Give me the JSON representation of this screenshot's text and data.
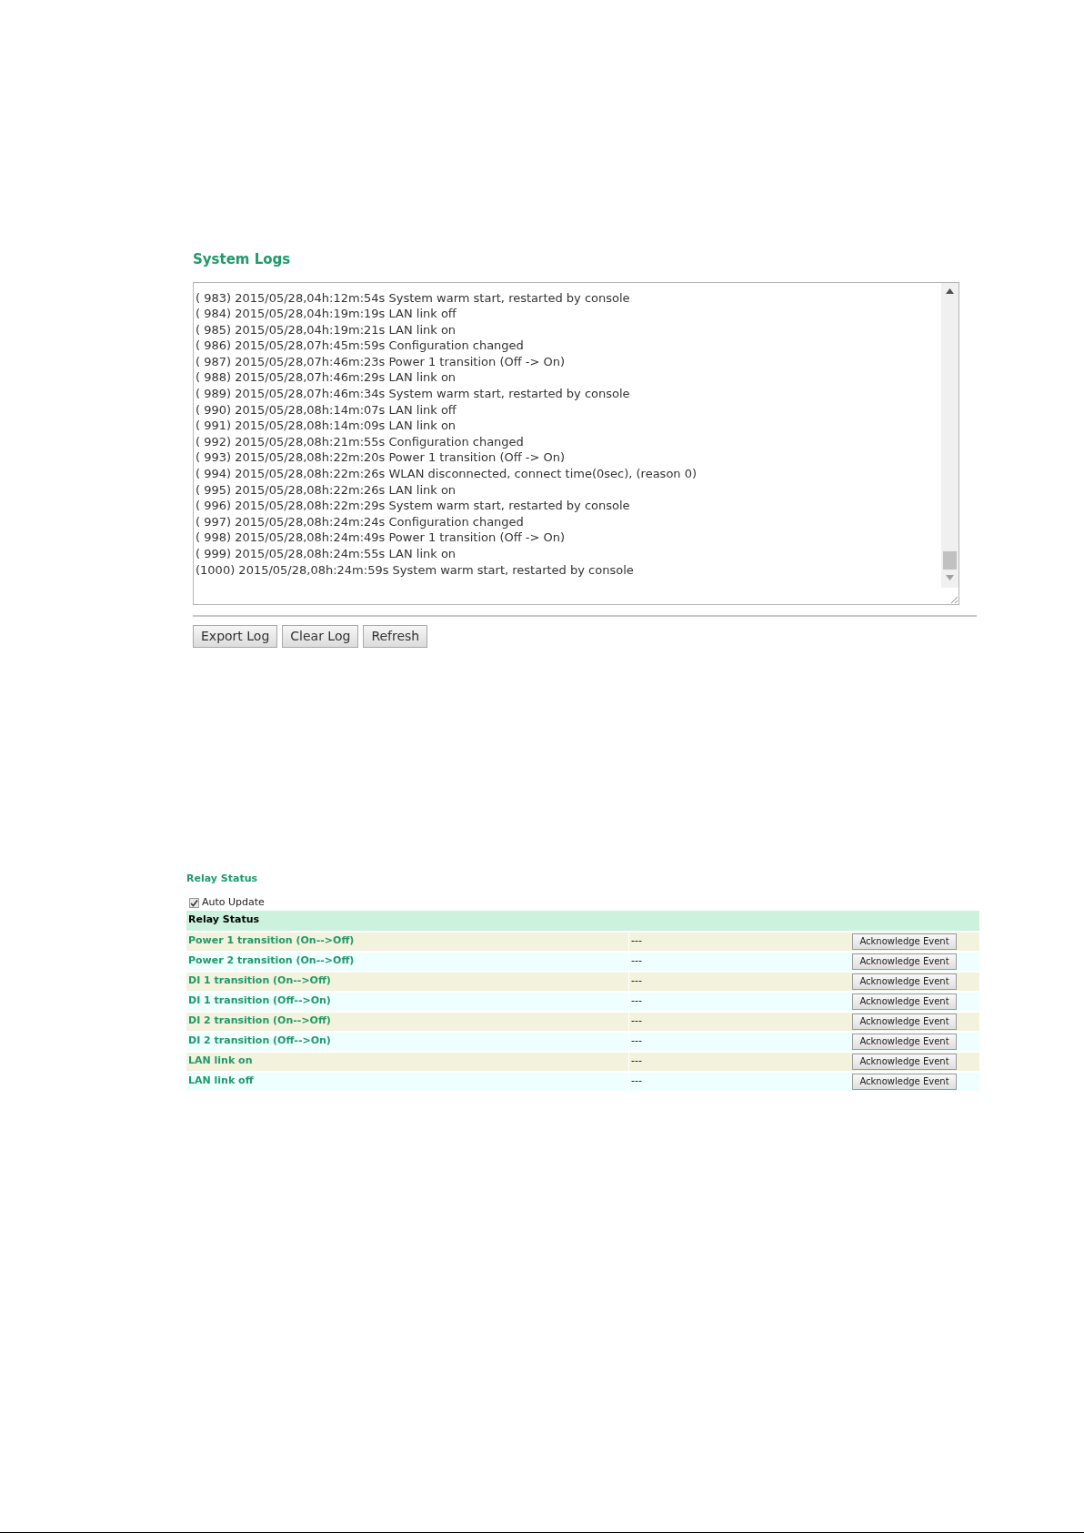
{
  "system_logs": {
    "title": "System Logs",
    "lines": [
      "( 983) 2015/05/28,04h:12m:54s System warm start, restarted by console",
      "( 984) 2015/05/28,04h:19m:19s LAN link off",
      "( 985) 2015/05/28,04h:19m:21s LAN link on",
      "( 986) 2015/05/28,07h:45m:59s Configuration changed",
      "( 987) 2015/05/28,07h:46m:23s Power 1 transition (Off -> On)",
      "( 988) 2015/05/28,07h:46m:29s LAN link on",
      "( 989) 2015/05/28,07h:46m:34s System warm start, restarted by console",
      "( 990) 2015/05/28,08h:14m:07s LAN link off",
      "( 991) 2015/05/28,08h:14m:09s LAN link on",
      "( 992) 2015/05/28,08h:21m:55s Configuration changed",
      "( 993) 2015/05/28,08h:22m:20s Power 1 transition (Off -> On)",
      "( 994) 2015/05/28,08h:22m:26s WLAN disconnected, connect time(0sec), (reason 0)",
      "( 995) 2015/05/28,08h:22m:26s LAN link on",
      "( 996) 2015/05/28,08h:22m:29s System warm start, restarted by console",
      "( 997) 2015/05/28,08h:24m:24s Configuration changed",
      "( 998) 2015/05/28,08h:24m:49s Power 1 transition (Off -> On)",
      "( 999) 2015/05/28,08h:24m:55s LAN link on",
      "(1000) 2015/05/28,08h:24m:59s System warm start, restarted by console"
    ],
    "buttons": [
      "Export Log",
      "Clear Log",
      "Refresh"
    ]
  },
  "relay_status": {
    "title": "Relay Status",
    "auto_update": {
      "label": "Auto Update",
      "checked": true
    },
    "table_heading": "Relay Status",
    "rows": [
      {
        "event": "Power 1 transition (On-->Off)",
        "status": "---",
        "button": "Acknowledge Event"
      },
      {
        "event": "Power 2 transition (On-->Off)",
        "status": "---",
        "button": "Acknowledge Event"
      },
      {
        "event": "DI 1 transition (On-->Off)",
        "status": "---",
        "button": "Acknowledge Event"
      },
      {
        "event": "DI 1 transition (Off-->On)",
        "status": "---",
        "button": "Acknowledge Event"
      },
      {
        "event": "DI 2 transition (On-->Off)",
        "status": "---",
        "button": "Acknowledge Event"
      },
      {
        "event": "DI 2 transition (Off-->On)",
        "status": "---",
        "button": "Acknowledge Event"
      },
      {
        "event": "LAN link on",
        "status": "---",
        "button": "Acknowledge Event"
      },
      {
        "event": "LAN link off",
        "status": "---",
        "button": "Acknowledge Event"
      }
    ]
  }
}
